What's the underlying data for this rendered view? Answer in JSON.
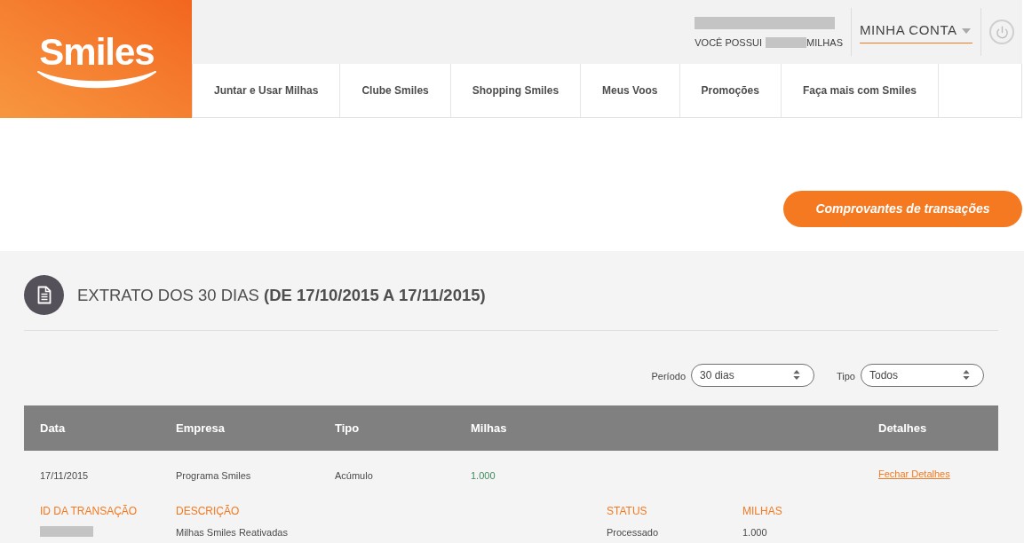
{
  "logo": {
    "text": "Smiles"
  },
  "account": {
    "name_redacted": true,
    "balance_prefix": "VOCÊ POSSUI",
    "balance_redacted": true,
    "balance_suffix": "MILHAS",
    "menu_label": "MINHA CONTA"
  },
  "nav": {
    "items": [
      "Juntar e Usar Milhas",
      "Clube Smiles",
      "Shopping Smiles",
      "Meus Voos",
      "Promoções",
      "Faça mais com Smiles"
    ]
  },
  "actions": {
    "receipts_button": "Comprovantes de transações"
  },
  "statement": {
    "title": "EXTRATO DOS 30 DIAS **(DE 17/10/2015 A 17/11/2015)**",
    "filters": [
      {
        "label": "Período",
        "value": "30 dias"
      },
      {
        "label": "Tipo",
        "value": "Todos"
      }
    ],
    "table": {
      "columns": [
        "Data",
        "Empresa",
        "Tipo",
        "Milhas",
        "Detalhes"
      ],
      "rows": [
        {
          "cells": [
            "17/11/2015",
            "Programa Smiles",
            "Acúmulo",
            "1.000"
          ],
          "details_link": "Fechar Detalhes",
          "details": [
            {
              "label": "ID DA TRANSAÇÃO",
              "redacted": true
            },
            {
              "label": "DESCRIÇÃO",
              "value": "Milhas Smiles Reativadas"
            },
            {
              "label": "STATUS",
              "value": "Processado"
            },
            {
              "label": "MILHAS",
              "value": "1.000"
            }
          ]
        }
      ]
    }
  }
}
